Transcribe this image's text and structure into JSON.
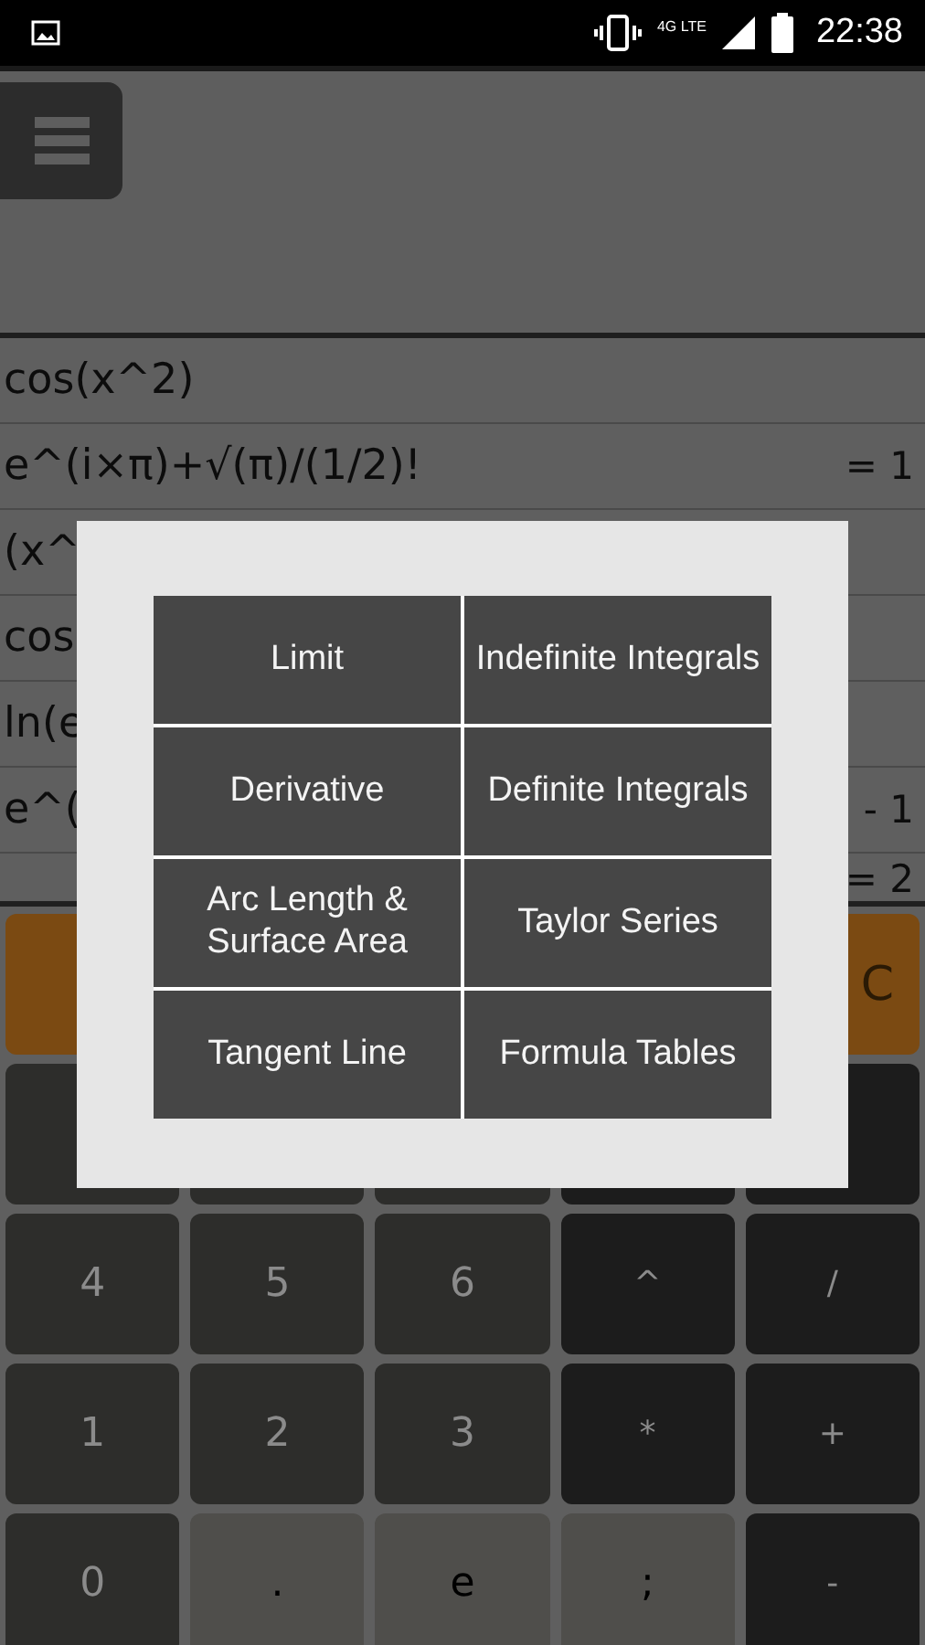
{
  "status_bar": {
    "network": "4G LTE",
    "time": "22:38"
  },
  "history": [
    {
      "expression": "cos(x^2)"
    },
    {
      "expression": "e^(i×π)+√(π)/(1/2)!",
      "result": "= 1"
    },
    {
      "expression": "(x^"
    },
    {
      "expression": "cos"
    },
    {
      "expression": "ln(e"
    },
    {
      "expression": "e^(",
      "result": "- 1"
    },
    {
      "result": "= 2"
    }
  ],
  "keypad": [
    [
      {
        "kind": "function"
      },
      {
        "kind": "covered"
      },
      {
        "kind": "covered"
      },
      {
        "kind": "covered"
      },
      {
        "label": "C",
        "kind": "function"
      }
    ],
    [
      {
        "kind": "number"
      },
      {
        "kind": "number"
      },
      {
        "kind": "number"
      },
      {
        "kind": "operator"
      },
      {
        "kind": "operator"
      }
    ],
    [
      {
        "label": "4",
        "kind": "number"
      },
      {
        "label": "5",
        "kind": "number"
      },
      {
        "label": "6",
        "kind": "number"
      },
      {
        "label": "^",
        "kind": "operator"
      },
      {
        "label": "/",
        "kind": "operator"
      }
    ],
    [
      {
        "label": "1",
        "kind": "number"
      },
      {
        "label": "2",
        "kind": "number"
      },
      {
        "label": "3",
        "kind": "number"
      },
      {
        "label": "*",
        "kind": "operator"
      },
      {
        "label": "+",
        "kind": "operator"
      }
    ],
    [
      {
        "label": "0",
        "kind": "number"
      },
      {
        "label": ".",
        "kind": "special"
      },
      {
        "label": "e",
        "kind": "special"
      },
      {
        "label": ";",
        "kind": "special"
      },
      {
        "label": "-",
        "kind": "operator"
      }
    ]
  ],
  "dialog": {
    "options": [
      "Limit",
      "Indefinite Integrals",
      "Derivative",
      "Definite Integrals",
      "Arc Length & Surface Area",
      "Taylor Series",
      "Tangent Line",
      "Formula Tables"
    ]
  }
}
